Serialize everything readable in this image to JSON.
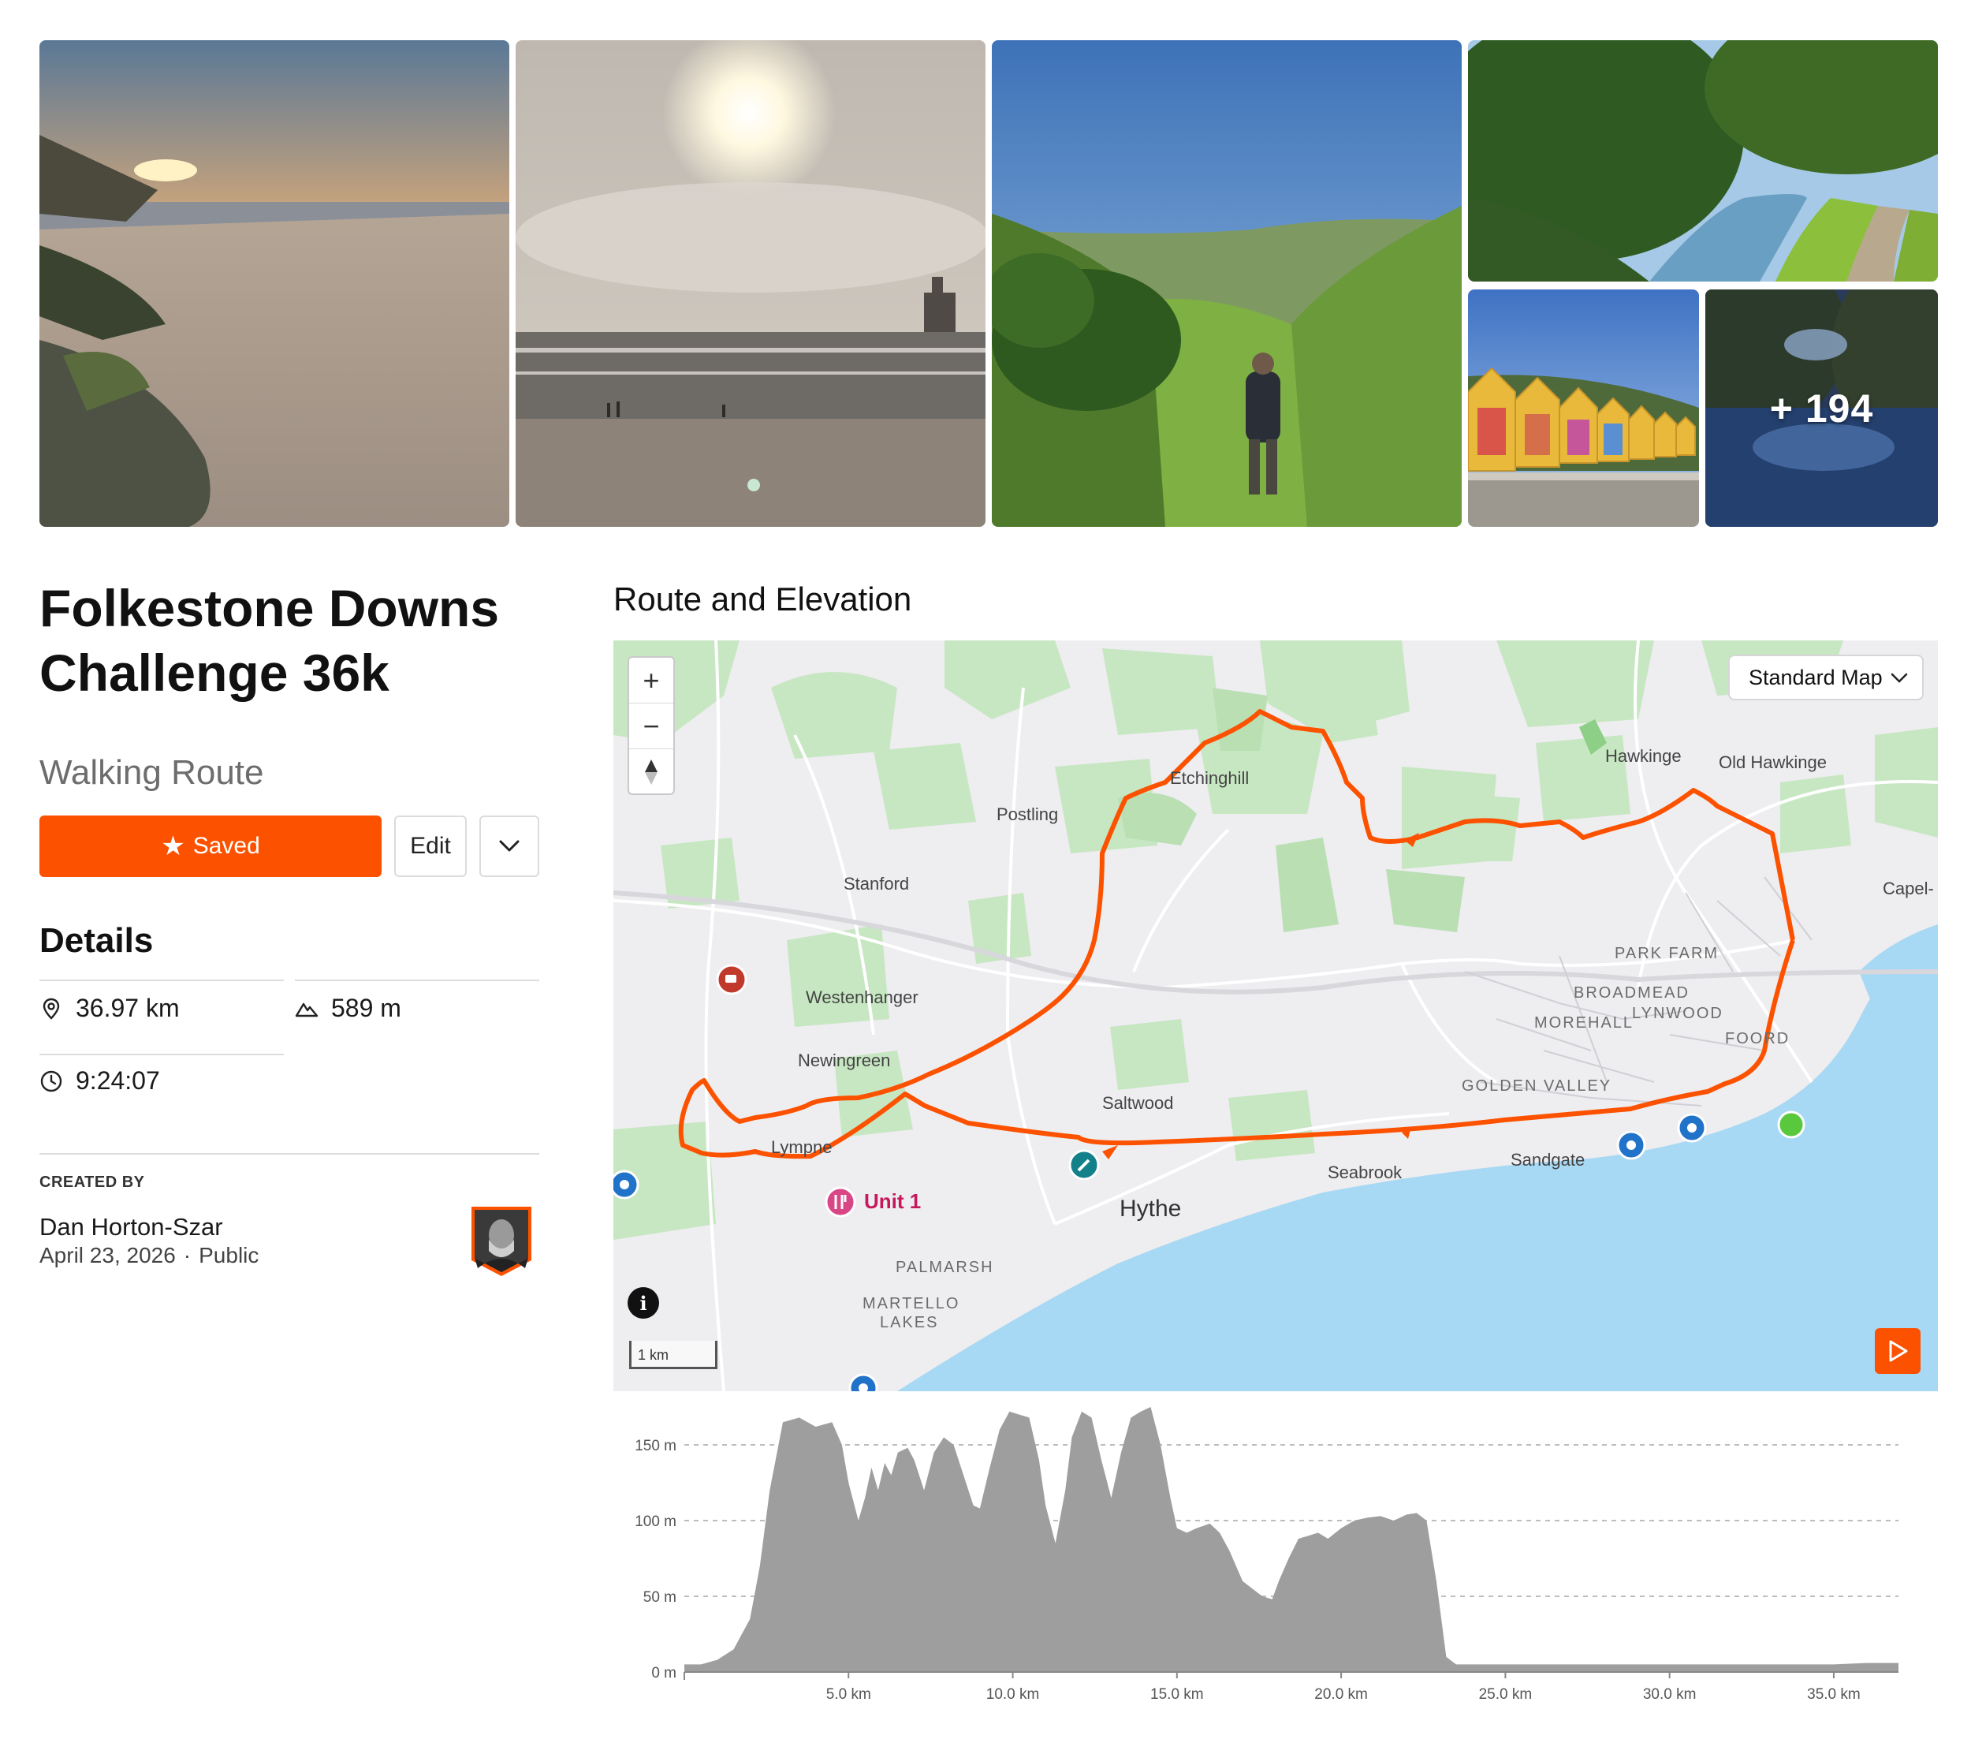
{
  "gallery": {
    "more_count": "+ 194"
  },
  "route": {
    "title": "Folkestone Downs Challenge 36k",
    "type": "Walking Route"
  },
  "actions": {
    "saved_label": "Saved",
    "edit_label": "Edit"
  },
  "details": {
    "heading": "Details",
    "distance": "36.97 km",
    "elevation_gain": "589 m",
    "time": "9:24:07"
  },
  "creator": {
    "heading": "CREATED BY",
    "name": "Dan Horton-Szar",
    "date": "April 23, 2026",
    "separator": "·",
    "visibility": "Public"
  },
  "map": {
    "section_title": "Route and Elevation",
    "map_type": "Standard Map",
    "zoom_in": "+",
    "zoom_out": "−",
    "scale": "1 km",
    "info": "i",
    "labels": {
      "etchinghill": "Etchinghill",
      "hawkinge": "Hawkinge",
      "old_hawkinge": "Old Hawkinge",
      "postling": "Postling",
      "stanford": "Stanford",
      "capel": "Capel-",
      "westenhanger": "Westenhanger",
      "park_farm": "PARK FARM",
      "broadmead": "BROADMEAD",
      "morehall": "MOREHALL",
      "lynwood": "LYNWOOD",
      "foord": "FOORD",
      "newingreen": "Newingreen",
      "golden_valley": "GOLDEN VALLEY",
      "saltwood": "Saltwood",
      "lympne": "Lympne",
      "seabrook": "Seabrook",
      "sandgate": "Sandgate",
      "unit1": "Unit 1",
      "hythe": "Hythe",
      "palmarsh": "PALMARSH",
      "martello": "MARTELLO",
      "lakes": "LAKES"
    }
  },
  "chart_data": {
    "type": "area",
    "title": "",
    "xlabel": "",
    "ylabel": "",
    "x_unit": "km",
    "y_unit": "m",
    "xlim": [
      0,
      36.97
    ],
    "ylim": [
      0,
      175
    ],
    "x_ticks": [
      "5.0 km",
      "10.0 km",
      "15.0 km",
      "20.0 km",
      "25.0 km",
      "30.0 km",
      "35.0 km"
    ],
    "y_ticks": [
      "0 m",
      "50 m",
      "100 m",
      "150 m"
    ],
    "x_tick_values": [
      5,
      10,
      15,
      20,
      25,
      30,
      35
    ],
    "y_tick_values": [
      0,
      50,
      100,
      150
    ],
    "grid": true,
    "series": [
      {
        "color": "#9e9e9e",
        "x": [
          0,
          0.5,
          1.0,
          1.5,
          2.0,
          2.3,
          2.6,
          3.0,
          3.5,
          4.0,
          4.5,
          4.8,
          5.0,
          5.3,
          5.5,
          5.7,
          5.9,
          6.1,
          6.3,
          6.5,
          6.8,
          7.0,
          7.3,
          7.6,
          7.9,
          8.2,
          8.5,
          8.8,
          9.0,
          9.3,
          9.6,
          9.9,
          10.2,
          10.5,
          10.8,
          11.0,
          11.3,
          11.6,
          11.8,
          12.1,
          12.4,
          12.7,
          13.0,
          13.3,
          13.6,
          13.9,
          14.2,
          14.5,
          14.8,
          15.0,
          15.3,
          15.6,
          16.0,
          16.3,
          16.6,
          17.0,
          17.3,
          17.6,
          17.9,
          18.1,
          18.4,
          18.7,
          19.0,
          19.3,
          19.6,
          20.0,
          20.4,
          20.8,
          21.2,
          21.6,
          22.0,
          22.3,
          22.6,
          22.9,
          23.2,
          23.5,
          24.0,
          25.0,
          26.0,
          27.0,
          28.0,
          29.0,
          30.0,
          31.0,
          32.0,
          33.0,
          34.0,
          35.0,
          36.0,
          36.97
        ],
        "y": [
          5,
          5,
          8,
          15,
          35,
          70,
          120,
          165,
          168,
          162,
          165,
          150,
          125,
          100,
          115,
          135,
          120,
          138,
          130,
          145,
          148,
          140,
          120,
          145,
          155,
          150,
          130,
          110,
          108,
          135,
          160,
          172,
          170,
          168,
          140,
          110,
          85,
          120,
          155,
          172,
          168,
          140,
          115,
          145,
          168,
          172,
          175,
          150,
          115,
          95,
          92,
          95,
          98,
          92,
          80,
          60,
          55,
          50,
          48,
          60,
          75,
          88,
          90,
          92,
          88,
          95,
          100,
          102,
          103,
          100,
          104,
          105,
          100,
          60,
          10,
          5,
          5,
          5,
          5,
          5,
          5,
          5,
          5,
          5,
          5,
          5,
          5,
          5,
          6,
          6
        ]
      }
    ]
  }
}
